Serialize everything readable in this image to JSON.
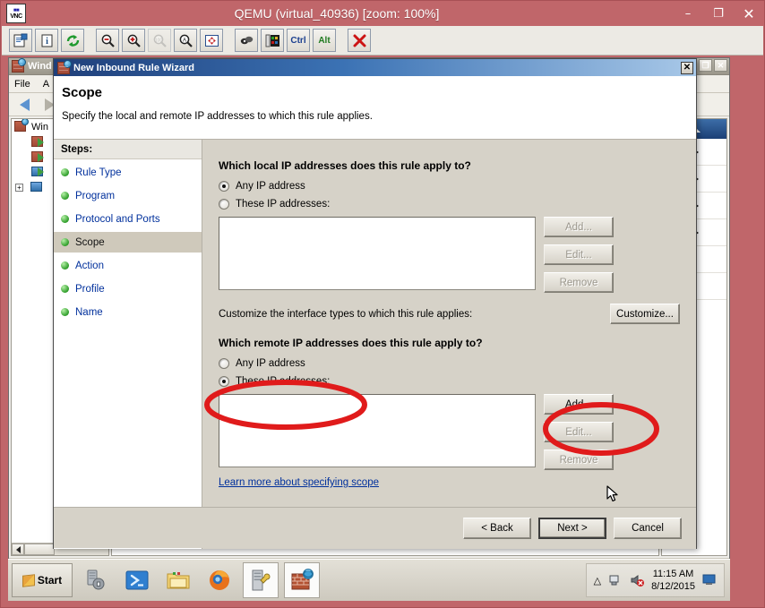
{
  "vnc": {
    "title": "QEMU (virtual_40936) [zoom: 100%]",
    "logo_line1": "VNC",
    "logo_line2": "VNC",
    "window_buttons": {
      "minimize": "–",
      "maximize": "❐",
      "close": "✕"
    },
    "toolbar": [
      {
        "name": "new-connection-icon",
        "label": ""
      },
      {
        "name": "connection-info-icon",
        "label": ""
      },
      {
        "name": "refresh-icon",
        "label": ""
      },
      {
        "name": "zoom-out-icon",
        "label": ""
      },
      {
        "name": "zoom-in-icon",
        "label": ""
      },
      {
        "name": "zoom-100-icon",
        "label": ""
      },
      {
        "name": "zoom-fit-icon",
        "label": ""
      },
      {
        "name": "fullscreen-icon",
        "label": ""
      },
      {
        "name": "options-icon",
        "label": ""
      },
      {
        "name": "send-keys-icon",
        "label": ""
      },
      {
        "name": "ctrl-key-button",
        "label": "Ctrl"
      },
      {
        "name": "alt-key-button",
        "label": "Alt"
      },
      {
        "name": "disconnect-icon",
        "label": ""
      }
    ]
  },
  "mmc": {
    "title": "Wind",
    "menu": [
      "File",
      "A"
    ],
    "tree_root": "Win",
    "actions_header": "",
    "topright_buttons": [
      "❐",
      "✕"
    ]
  },
  "dialog": {
    "title": "New Inbound Rule Wizard",
    "close_label": "✕",
    "heading": "Scope",
    "subheading": "Specify the local and remote IP addresses to which this rule applies.",
    "steps_header": "Steps:",
    "steps": [
      {
        "label": "Rule Type",
        "current": false
      },
      {
        "label": "Program",
        "current": false
      },
      {
        "label": "Protocol and Ports",
        "current": false
      },
      {
        "label": "Scope",
        "current": true
      },
      {
        "label": "Action",
        "current": false
      },
      {
        "label": "Profile",
        "current": false
      },
      {
        "label": "Name",
        "current": false
      }
    ],
    "local": {
      "question": "Which local IP addresses does this rule apply to?",
      "option_any": "Any IP address",
      "option_these": "These IP addresses:",
      "selected": "any",
      "list_items": [],
      "buttons": {
        "add": "Add...",
        "edit": "Edit...",
        "remove": "Remove"
      }
    },
    "customize": {
      "text": "Customize the interface types to which this rule applies:",
      "button": "Customize..."
    },
    "remote": {
      "question": "Which remote IP addresses does this rule apply to?",
      "option_any": "Any IP address",
      "option_these": "These IP addresses:",
      "selected": "these",
      "list_items": [],
      "buttons": {
        "add": "Add...",
        "edit": "Edit...",
        "remove": "Remove"
      }
    },
    "learn_more": "Learn more about specifying scope",
    "footer": {
      "back": "< Back",
      "next": "Next >",
      "cancel": "Cancel"
    }
  },
  "annotations": {
    "color": "#e01b1b",
    "ellipses": [
      {
        "name": "highlight-these-ip-addresses-radio"
      },
      {
        "name": "highlight-add-button"
      }
    ]
  },
  "taskbar": {
    "start_label": "Start",
    "apps": [
      {
        "name": "server-manager",
        "active": false
      },
      {
        "name": "powershell",
        "active": false
      },
      {
        "name": "file-explorer",
        "active": false
      },
      {
        "name": "firefox",
        "active": false
      },
      {
        "name": "windows-firewall-console",
        "active": true
      },
      {
        "name": "new-inbound-rule-wizard",
        "active": true
      }
    ],
    "tray": {
      "time": "11:15 AM",
      "date": "8/12/2015"
    }
  }
}
